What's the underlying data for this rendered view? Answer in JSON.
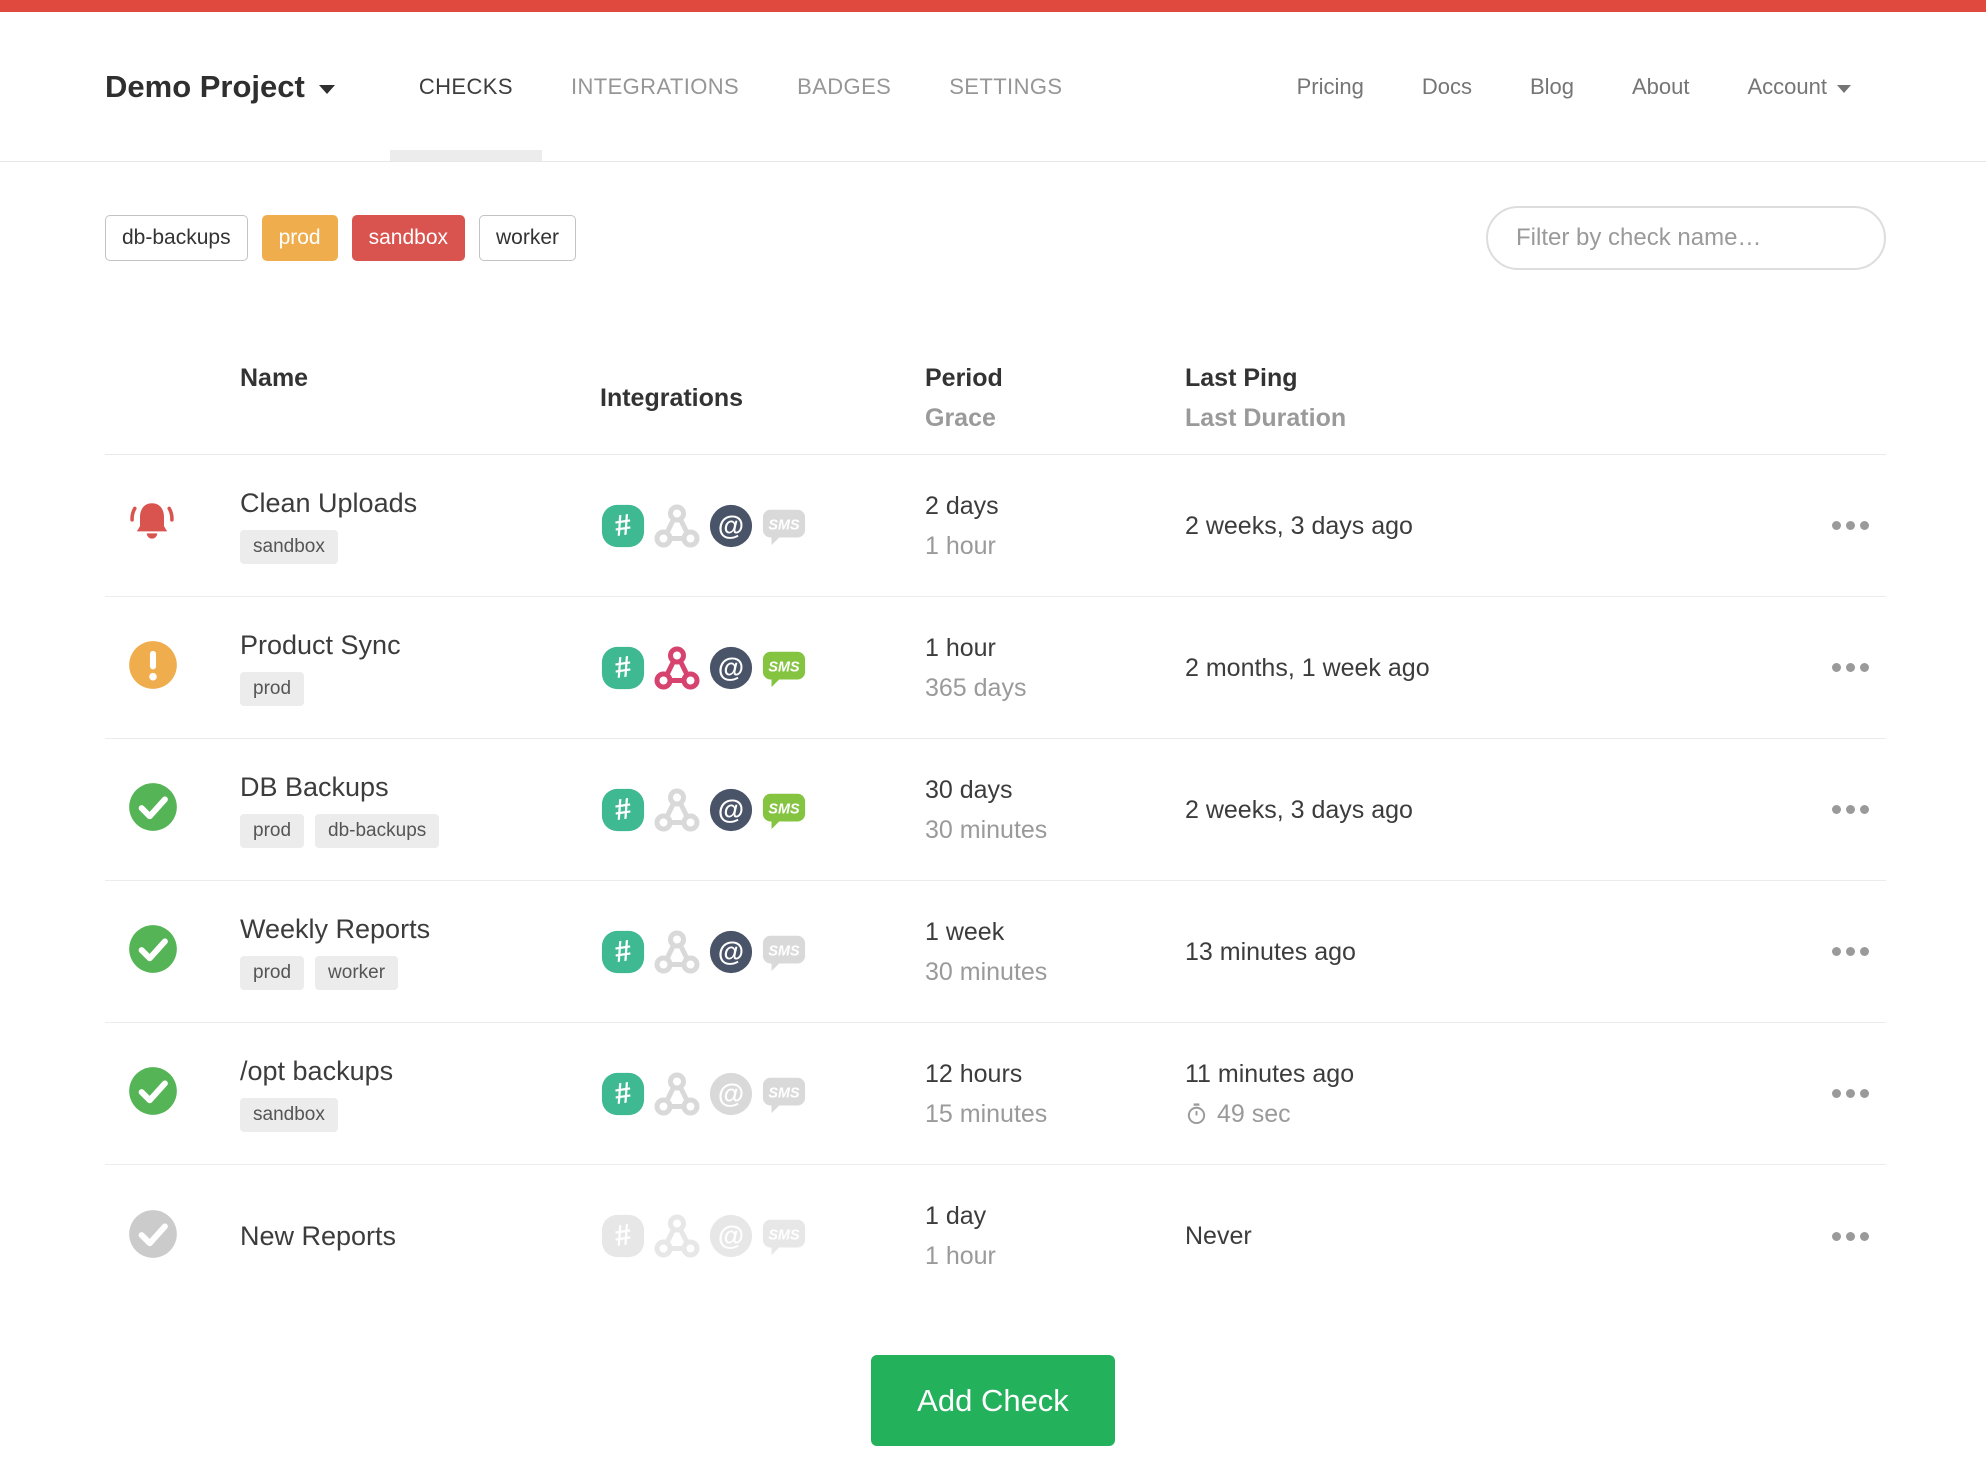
{
  "header": {
    "project_name": "Demo Project",
    "tabs": [
      {
        "label": "CHECKS",
        "active": true
      },
      {
        "label": "INTEGRATIONS",
        "active": false
      },
      {
        "label": "BADGES",
        "active": false
      },
      {
        "label": "SETTINGS",
        "active": false
      }
    ],
    "links": [
      "Pricing",
      "Docs",
      "Blog",
      "About"
    ],
    "account_label": "Account"
  },
  "filters": {
    "tags": [
      {
        "label": "db-backups",
        "style": "default"
      },
      {
        "label": "prod",
        "style": "orange"
      },
      {
        "label": "sandbox",
        "style": "red"
      },
      {
        "label": "worker",
        "style": "default"
      }
    ],
    "search_placeholder": "Filter by check name…"
  },
  "table": {
    "headers": {
      "name": "Name",
      "integrations": "Integrations",
      "period": "Period",
      "grace": "Grace",
      "last_ping": "Last Ping",
      "last_duration": "Last Duration"
    },
    "rows": [
      {
        "status": "alert",
        "name": "Clean Uploads",
        "tags": [
          "sandbox"
        ],
        "integrations": {
          "slack": "on",
          "webhook": "off",
          "email": "on",
          "sms": "off"
        },
        "period": "2 days",
        "grace": "1 hour",
        "last_ping": "2 weeks, 3 days ago",
        "last_duration": ""
      },
      {
        "status": "grace",
        "name": "Product Sync",
        "tags": [
          "prod"
        ],
        "integrations": {
          "slack": "on",
          "webhook": "on",
          "email": "on",
          "sms": "on"
        },
        "period": "1 hour",
        "grace": "365 days",
        "last_ping": "2 months, 1 week ago",
        "last_duration": ""
      },
      {
        "status": "up",
        "name": "DB Backups",
        "tags": [
          "prod",
          "db-backups"
        ],
        "integrations": {
          "slack": "on",
          "webhook": "off",
          "email": "on",
          "sms": "on"
        },
        "period": "30 days",
        "grace": "30 minutes",
        "last_ping": "2 weeks, 3 days ago",
        "last_duration": ""
      },
      {
        "status": "up",
        "name": "Weekly Reports",
        "tags": [
          "prod",
          "worker"
        ],
        "integrations": {
          "slack": "on",
          "webhook": "off",
          "email": "on",
          "sms": "off"
        },
        "period": "1 week",
        "grace": "30 minutes",
        "last_ping": "13 minutes ago",
        "last_duration": ""
      },
      {
        "status": "up",
        "name": "/opt backups",
        "tags": [
          "sandbox"
        ],
        "integrations": {
          "slack": "on",
          "webhook": "off",
          "email": "off",
          "sms": "off"
        },
        "period": "12 hours",
        "grace": "15 minutes",
        "last_ping": "11 minutes ago",
        "last_duration": "49 sec"
      },
      {
        "status": "new",
        "name": "New Reports",
        "tags": [],
        "integrations": {
          "slack": "muted",
          "webhook": "muted",
          "email": "muted",
          "sms": "muted"
        },
        "period": "1 day",
        "grace": "1 hour",
        "last_ping": "Never",
        "last_duration": ""
      }
    ]
  },
  "add_check_label": "Add Check",
  "colors": {
    "topbar": "#e04a3e",
    "status_alert": "#d9534f",
    "status_grace": "#f0ad4e",
    "status_up": "#55b456",
    "status_new": "#cbcbcb",
    "slack_on": "#3eb991",
    "webhook_on": "#d6436e",
    "email_on": "#4a5468",
    "sms_on": "#84c441",
    "icon_off": "#d9d9d9",
    "icon_muted": "#e7e7e7",
    "accent_green": "#24b15b"
  }
}
